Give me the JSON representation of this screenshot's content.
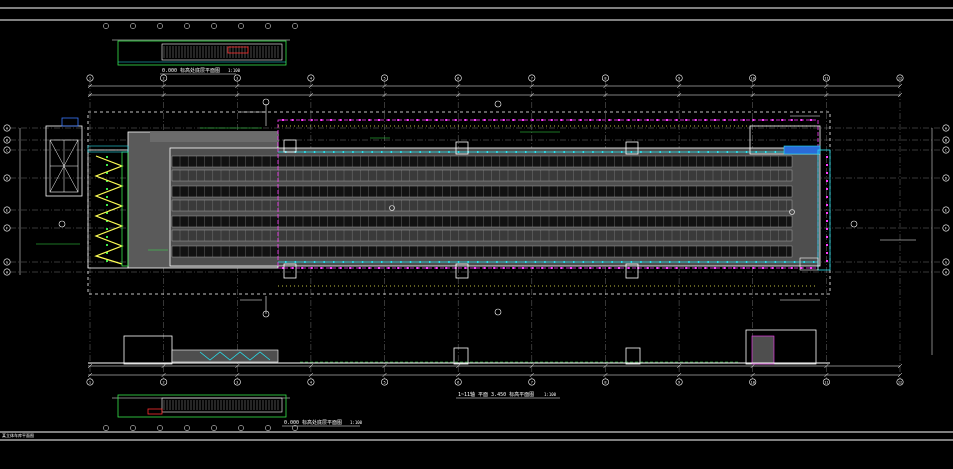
{
  "drawing": {
    "top_detail_title": "0.000  标高处底层平面图",
    "top_detail_scale": "1:100",
    "main_plan_title": "1~11轴  平面  3.450  标高平面图",
    "main_plan_scale": "1:100",
    "bottom_detail_title": "0.000  标高处底层平面图",
    "bottom_detail_scale": "1:100",
    "corner_note": "某立体车库平面图",
    "axis_labels": [
      "1",
      "2",
      "3",
      "4",
      "5",
      "6",
      "7",
      "8",
      "9",
      "10",
      "11",
      "12",
      "13",
      "14",
      "15",
      "16",
      "17",
      "18",
      "19",
      "20"
    ],
    "row_labels": [
      "A",
      "B",
      "C",
      "D",
      "E",
      "F",
      "G",
      "H"
    ]
  },
  "colors": {
    "background": "#000000",
    "outline": "#ffffff",
    "axis_line": "#d9d9d9",
    "dimension": "#ffffff",
    "cyan": "#29e3f0",
    "magenta": "#ff3cff",
    "green": "#37e64b",
    "yellow": "#ffff55",
    "red": "#ff3030",
    "blue": "#3a78ff"
  }
}
